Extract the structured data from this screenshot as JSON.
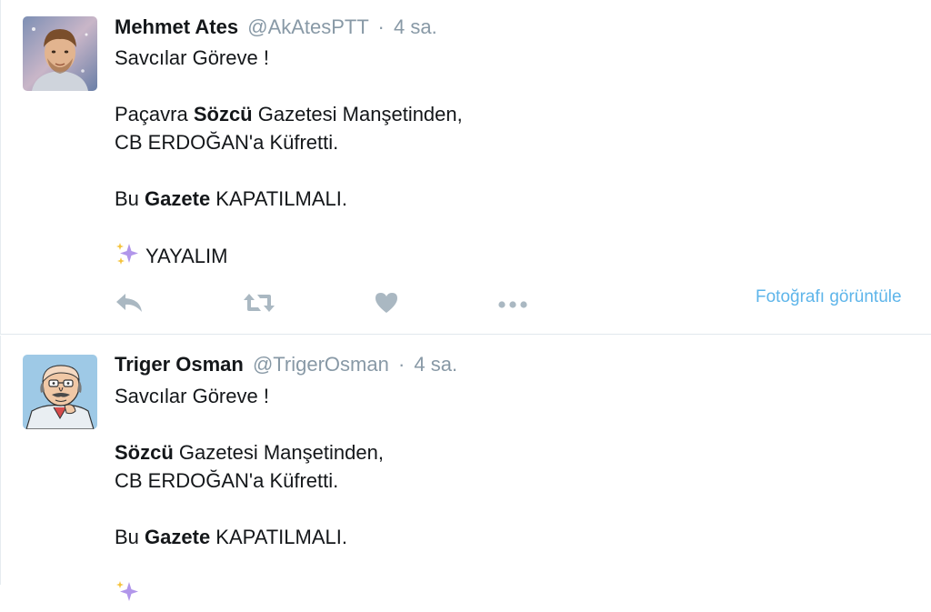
{
  "tweets": [
    {
      "name": "Mehmet Ates",
      "handle": "@AkAtesPTT",
      "separator": "·",
      "time": "4 sa.",
      "line1": "Savcılar Göreve !",
      "line2_pre": "Paçavra ",
      "line2_bold": "Sözcü",
      "line2_post": " Gazetesi Manşetinden,",
      "line3": "CB ERDOĞAN'a Küfretti.",
      "line4_pre": "Bu ",
      "line4_bold": "Gazete",
      "line4_post": " KAPATILMALI.",
      "line5": "YAYALIM",
      "view_photo": "Fotoğrafı görüntüle"
    },
    {
      "name": "Triger Osman",
      "handle": "@TrigerOsman",
      "separator": "·",
      "time": "4 sa.",
      "line1": "Savcılar Göreve !",
      "line2_bold": "Sözcü",
      "line2_post": " Gazetesi Manşetinden,",
      "line3": "CB ERDOĞAN'a Küfretti.",
      "line4_pre": "Bu ",
      "line4_bold": "Gazete",
      "line4_post": " KAPATILMALI."
    }
  ],
  "icons": {
    "reply": "reply-icon",
    "retweet": "retweet-icon",
    "like": "heart-icon",
    "more": "more-icon",
    "sparkles": "sparkles-icon"
  },
  "colors": {
    "name": "#14171a",
    "meta": "#8899a6",
    "link": "#5eb5ea",
    "action_icon": "#aab8c2",
    "sparkle_purple": "#b196ea",
    "sparkle_yellow": "#f5c33b"
  }
}
